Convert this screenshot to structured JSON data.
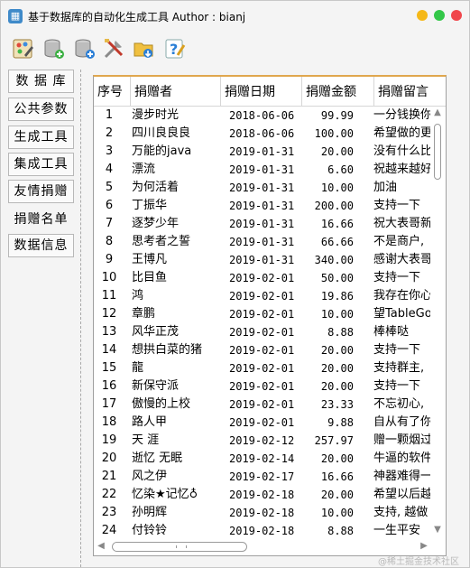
{
  "window": {
    "title": "基于数据库的自动化生成工具  Author : bianj",
    "app_icon": "table-app-icon"
  },
  "toolbar": {
    "tools": [
      {
        "name": "palette-tool-icon"
      },
      {
        "name": "database-add-icon"
      },
      {
        "name": "database-add-blue-icon"
      },
      {
        "name": "tools-icon"
      },
      {
        "name": "folder-download-icon"
      },
      {
        "name": "help-icon"
      }
    ]
  },
  "nav": {
    "items": [
      {
        "label": "数 据 库"
      },
      {
        "label": "公共参数"
      },
      {
        "label": "生成工具"
      },
      {
        "label": "集成工具"
      },
      {
        "label": "友情捐赠"
      },
      {
        "label": "捐赠名单"
      },
      {
        "label": "数据信息"
      }
    ],
    "active_index": 5
  },
  "table": {
    "columns": [
      "序号",
      "捐赠者",
      "捐赠日期",
      "捐赠金额",
      "捐赠留言"
    ],
    "rows": [
      [
        "1",
        "漫步时光",
        "2018-06-06",
        "99.99",
        "一分钱换你"
      ],
      [
        "2",
        "四川良良良",
        "2018-06-06",
        "100.00",
        "希望做的更"
      ],
      [
        "3",
        "万能的java",
        "2019-01-31",
        "20.00",
        "没有什么比"
      ],
      [
        "4",
        "漂流",
        "2019-01-31",
        "6.60",
        "祝越来越好"
      ],
      [
        "5",
        "为何活着",
        "2019-01-31",
        "10.00",
        "加油"
      ],
      [
        "6",
        "丁振华",
        "2019-01-31",
        "200.00",
        "支持一下"
      ],
      [
        "7",
        "逐梦少年",
        "2019-01-31",
        "16.66",
        "祝大表哥新"
      ],
      [
        "8",
        "思考者之誓",
        "2019-01-31",
        "66.66",
        "不是商户,"
      ],
      [
        "9",
        "王博凡",
        "2019-01-31",
        "340.00",
        "感谢大表哥"
      ],
      [
        "10",
        "比目鱼",
        "2019-02-01",
        "50.00",
        "支持一下"
      ],
      [
        "11",
        "鸿",
        "2019-02-01",
        "19.86",
        "我存在你心"
      ],
      [
        "12",
        "章鹏",
        "2019-02-01",
        "10.00",
        "望TableGo"
      ],
      [
        "13",
        "风华正茂",
        "2019-02-01",
        "8.88",
        "棒棒哒"
      ],
      [
        "14",
        "想拱白菜的猪",
        "2019-02-01",
        "20.00",
        "支持一下"
      ],
      [
        "15",
        "龍",
        "2019-02-01",
        "20.00",
        "支持群主,"
      ],
      [
        "16",
        "新保守派",
        "2019-02-01",
        "20.00",
        "支持一下"
      ],
      [
        "17",
        "傲慢的上校",
        "2019-02-01",
        "23.33",
        "不忘初心,"
      ],
      [
        "18",
        "路人甲",
        "2019-02-01",
        "9.88",
        "自从有了你"
      ],
      [
        "19",
        "天 涯",
        "2019-02-12",
        "257.97",
        "赠一颗烟过"
      ],
      [
        "20",
        "逝忆  无眠",
        "2019-02-14",
        "20.00",
        "牛逼的软件"
      ],
      [
        "21",
        "风之伊",
        "2019-02-17",
        "16.66",
        "神器难得一"
      ],
      [
        "22",
        "忆染★记忆♁",
        "2019-02-18",
        "20.00",
        "希望以后越"
      ],
      [
        "23",
        "孙明辉",
        "2019-02-18",
        "10.00",
        "支持, 越做"
      ],
      [
        "24",
        "付铃铃",
        "2019-02-18",
        "8.88",
        "一生平安"
      ]
    ]
  },
  "watermark": "@稀土掘金技术社区",
  "colors": {
    "accent": "#e0a74e",
    "close": "#f0464c",
    "minimize": "#f5b818",
    "maximize": "#33c748"
  }
}
